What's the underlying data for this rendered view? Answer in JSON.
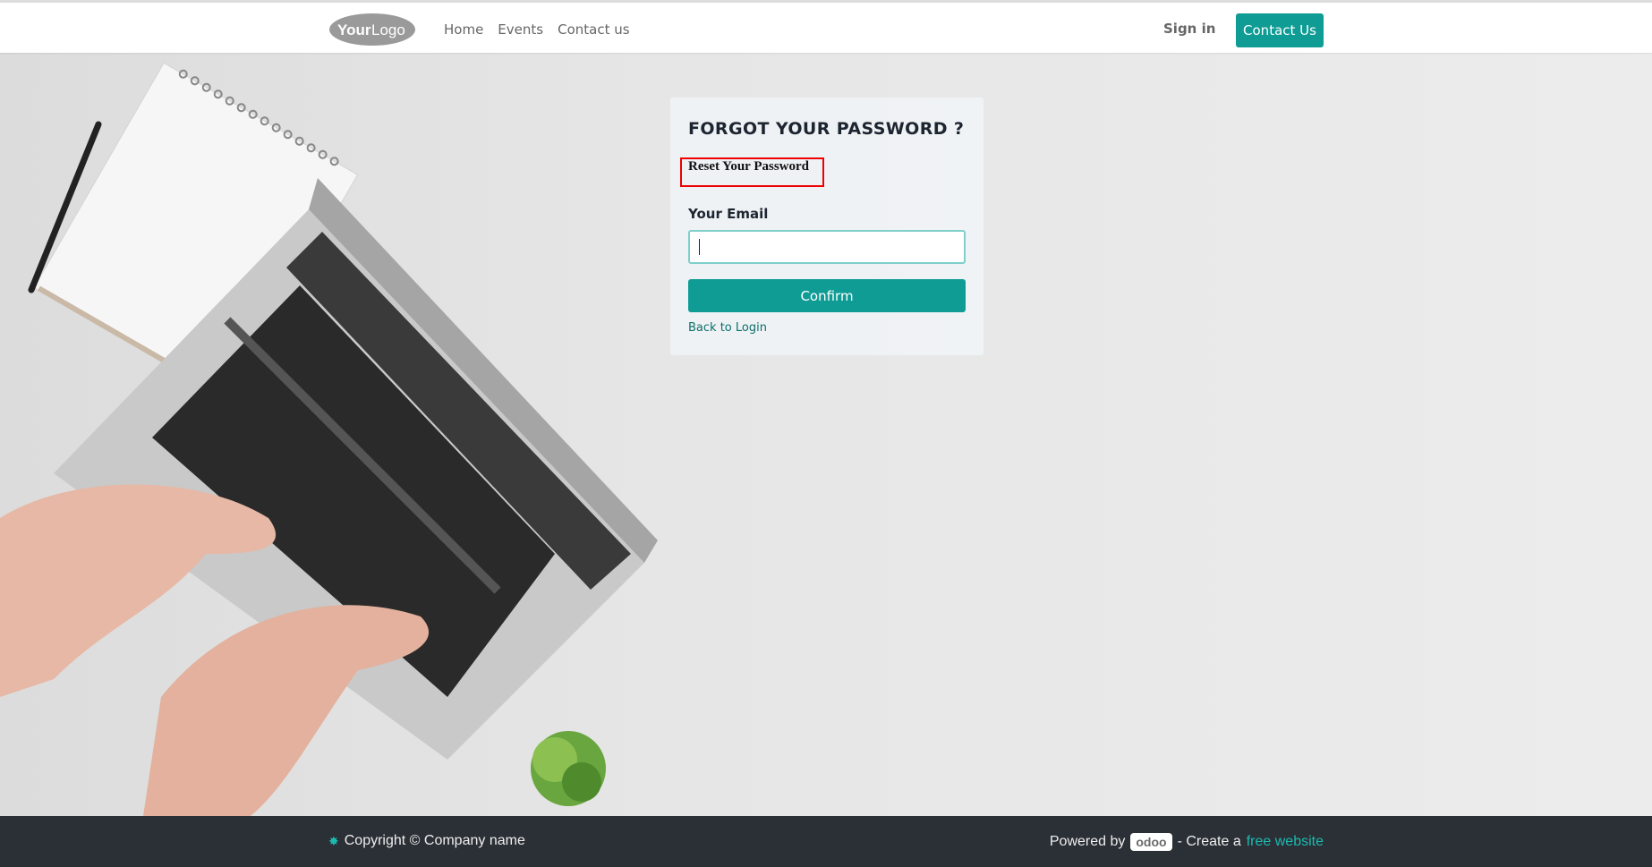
{
  "header": {
    "logo_text": "YourLogo",
    "nav": [
      "Home",
      "Events",
      "Contact us"
    ],
    "signin": "Sign in",
    "contact_button": "Contact Us"
  },
  "form": {
    "heading": "FORGOT YOUR PASSWORD ?",
    "subheading": "Reset Your Password",
    "email_label": "Your Email",
    "email_value": "",
    "confirm": "Confirm",
    "back_link": "Back to Login"
  },
  "footer": {
    "copyright": "Copyright © Company name",
    "powered_by": "Powered by",
    "odoo": "odoo",
    "create_text": "- Create a",
    "free_link": "free website"
  },
  "colors": {
    "accent": "#0e9c95",
    "footer_bg": "#2b3036"
  }
}
